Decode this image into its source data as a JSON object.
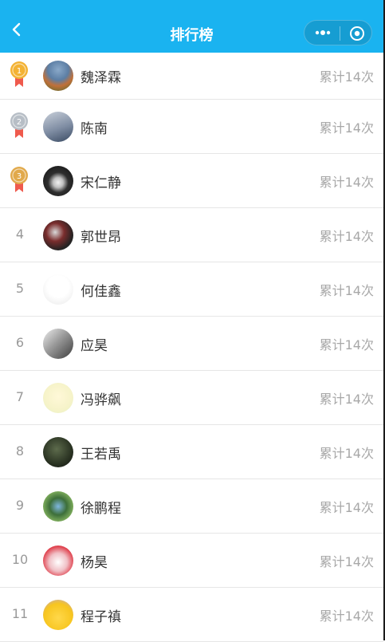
{
  "header": {
    "title": "排行榜",
    "bg_color": "#1ab3f0",
    "back_icon": "chevron-left-icon",
    "more_icon": "more-dots-icon",
    "close_icon": "target-circle-icon"
  },
  "medal_colors": {
    "gold": "#f3b233",
    "silver": "#b7bec6",
    "bronze": "#e1a94b",
    "ribbon": "#ef5a4d"
  },
  "leaderboard": [
    {
      "rank": "1",
      "name": "魏泽霖",
      "count": "累计14次",
      "medal": "gold"
    },
    {
      "rank": "2",
      "name": "陈南",
      "count": "累计14次",
      "medal": "silver"
    },
    {
      "rank": "3",
      "name": "宋仁静",
      "count": "累计14次",
      "medal": "bronze"
    },
    {
      "rank": "4",
      "name": "郭世昂",
      "count": "累计14次"
    },
    {
      "rank": "5",
      "name": "何佳鑫",
      "count": "累计14次"
    },
    {
      "rank": "6",
      "name": "应昊",
      "count": "累计14次"
    },
    {
      "rank": "7",
      "name": "冯骅飙",
      "count": "累计14次"
    },
    {
      "rank": "8",
      "name": "王若禹",
      "count": "累计14次"
    },
    {
      "rank": "9",
      "name": "徐鹏程",
      "count": "累计14次"
    },
    {
      "rank": "10",
      "name": "杨昊",
      "count": "累计14次"
    },
    {
      "rank": "11",
      "name": "程子禛",
      "count": "累计14次"
    }
  ]
}
